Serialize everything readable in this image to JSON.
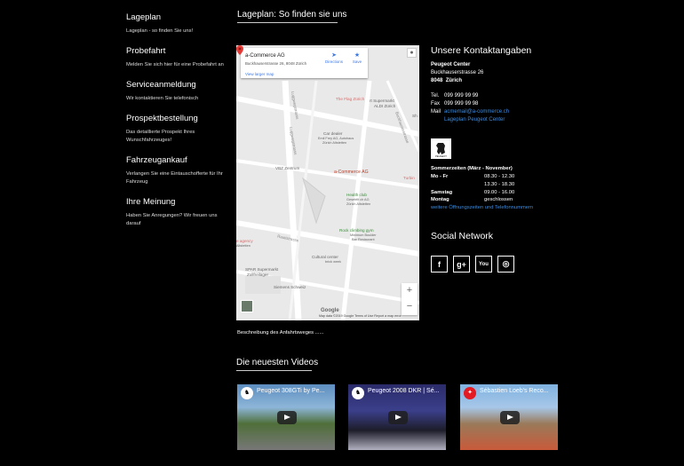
{
  "sidebar": {
    "items": [
      {
        "title": "Lageplan",
        "desc": "Lageplan - so finden Sie uns!"
      },
      {
        "title": "Probefahrt",
        "desc": "Melden Sie sich hier für eine Probefahrt an"
      },
      {
        "title": "Serviceanmeldung",
        "desc": "Wir kontaktieren Sie telefonisch"
      },
      {
        "title": "Prospektbestellung",
        "desc": "Das detaillierte Prospekt Ihres Wunschfahrzeuges!"
      },
      {
        "title": "Fahrzeugankauf",
        "desc": "Verlangen Sie eine Eintauschofferte für Ihr Fahrzeug"
      },
      {
        "title": "Ihre Meinung",
        "desc": "Haben Sie Anregungen? Wir freuen uns darauf"
      }
    ]
  },
  "main": {
    "heading": "Lageplan: So finden sie uns",
    "caption": "Beschreibung des Anfahrtsweges ......"
  },
  "map": {
    "place_name": "a-Commerce AG",
    "place_address": "Buckhauserstrasse 26, 8048 Zürich",
    "directions_label": "Directions",
    "save_label": "Save",
    "larger_map_link": "View larger map",
    "marker_label": "a-Commerce AG",
    "google_label": "Google",
    "footer": "Map data ©2019 Google   Terms of Use   Report a map error",
    "zoom_in": "+",
    "zoom_out": "−",
    "labels": {
      "supermarket_top": "rt Supermarkt",
      "supermarket_top2": "ALDI Zürich",
      "flag": "The Flag Zürich",
      "shop": "Sh",
      "car_dealer": "Car dealer",
      "car_dealer2": "Emil Frey AG, Autohaus",
      "car_dealer3": "Zürich Altstetten",
      "vbz": "VBZ Zentrum",
      "turbin": "Turbin",
      "health": "Health club",
      "health2": "Gesehfit ch AG",
      "health3": "Zürich Altstetten",
      "rock": "Rock climbing gym",
      "rock2": "Minimum Boulder",
      "rock3": "Bar Restaurant",
      "agency": "e agency",
      "agency2": "Altstetten",
      "cultural": "Cultural center",
      "cultural2": "brick week",
      "spar": "SPAR Supermarkt",
      "spar2": "Zollfreilager",
      "siemens": "Siemens Schweiz",
      "street_a": "Luggwegstrasse",
      "street_b": "Rautistrasse",
      "street_c": "Luggwegstrasse",
      "street_d": "Buckhauserstrasse"
    }
  },
  "contact": {
    "title": "Unsere Kontaktangaben",
    "company": "Peugeot Center",
    "street": "Buckhauserstrasse 26",
    "zip": "8048",
    "city": "Zürich",
    "tel_label": "Tel.",
    "tel": "099 999 99 99",
    "fax_label": "Fax",
    "fax": "099 999 99 98",
    "mail_label": "Mail",
    "mail": "acmemail@a-commerce.ch",
    "map_link": "Lageplan Peugeot Center",
    "logo_text": "PEUGEOT"
  },
  "hours": {
    "title": "Sommerzeiten  (März - November)",
    "rows": [
      {
        "day": "Mo - Fr",
        "time": "08.30 - 12.30"
      },
      {
        "day": "",
        "time": "13.30 - 18.30"
      },
      {
        "day": "Samstag",
        "time": "09.00 - 16.00"
      },
      {
        "day": "Montag",
        "time": "geschlossen"
      }
    ],
    "more_link": "weitere Öffnungszeiten und Telefonnummern"
  },
  "social": {
    "title": "Social Network",
    "icons": [
      "facebook-icon",
      "google-plus-icon",
      "youtube-icon",
      "instagram-icon"
    ],
    "glyphs": [
      "f",
      "g+",
      "You",
      "◎"
    ]
  },
  "videos": {
    "title": "Die neuesten Videos",
    "items": [
      {
        "title": "Peugeot 308GTi by Pe..."
      },
      {
        "title": "Peugeot 2008 DKR | Sé..."
      },
      {
        "title": "Sébastien Loeb's Reco..."
      }
    ]
  }
}
